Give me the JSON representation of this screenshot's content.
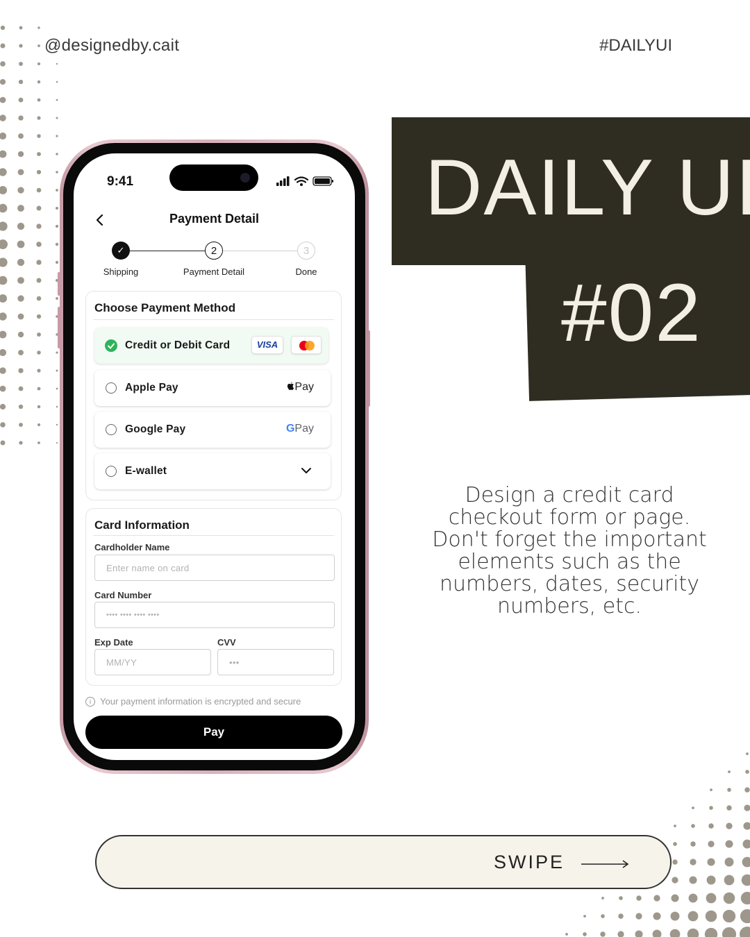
{
  "header": {
    "handle": "@designedby.cait",
    "hashtag": "#DAILYUI"
  },
  "title": {
    "daily_ui": "DAILY UI",
    "number": "#02"
  },
  "description": "Design a credit card checkout form or page. Don't forget the important elements such as the numbers, dates, security numbers, etc.",
  "swipe": {
    "label": "SWIPE"
  },
  "colors": {
    "dark_block": "#2f2d22",
    "title_text": "#f3efe4",
    "success_green": "#2fb35a",
    "pay_button": "#000000",
    "phone_frame": "#d7b1bb"
  },
  "phone": {
    "status_bar": {
      "time": "9:41"
    },
    "nav": {
      "back_icon": "chevron-left-icon",
      "title": "Payment Detail"
    },
    "stepper": {
      "steps": [
        {
          "label": "Shipping",
          "marker": "✓",
          "state": "done"
        },
        {
          "label": "Payment Detail",
          "marker": "2",
          "state": "current"
        },
        {
          "label": "Done",
          "marker": "3",
          "state": "upcoming"
        }
      ]
    },
    "payment_methods": {
      "title": "Choose Payment Method",
      "options": [
        {
          "label": "Credit or Debit Card",
          "selected": true,
          "logos": [
            "VISA",
            "mastercard"
          ]
        },
        {
          "label": "Apple Pay",
          "selected": false,
          "logo": "Pay"
        },
        {
          "label": "Google Pay",
          "selected": false,
          "logo_g": "G",
          "logo": "Pay"
        },
        {
          "label": "E-wallet",
          "selected": false,
          "icon": "chevron-down-icon"
        }
      ]
    },
    "card_info": {
      "title": "Card Information",
      "cardholder": {
        "label": "Cardholder Name",
        "placeholder": "Enter name on card"
      },
      "card_number": {
        "label": "Card Number",
        "placeholder": "•••• •••• •••• ••••"
      },
      "exp_date": {
        "label": "Exp Date",
        "placeholder": "MM/YY"
      },
      "cvv": {
        "label": "CVV",
        "placeholder": "•••"
      }
    },
    "security_note": "Your payment information is encrypted and secure",
    "pay_button": "Pay"
  }
}
